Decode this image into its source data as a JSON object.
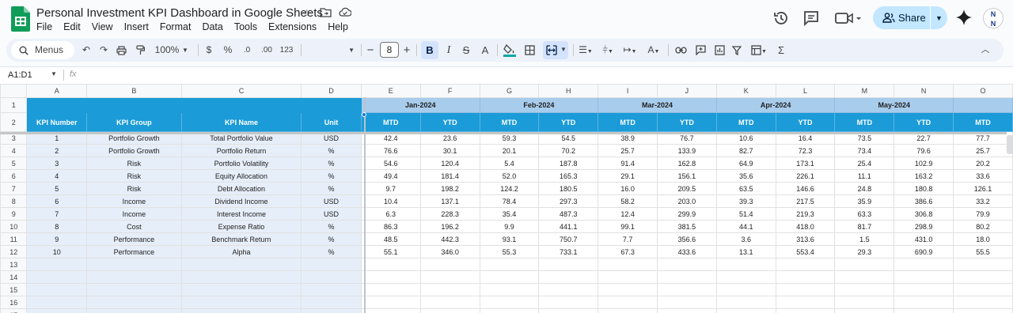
{
  "app": {
    "doc_title": "Personal Investment KPI Dashboard in Google Sheets",
    "share_label": "Share",
    "avatar_initials": "N\nN"
  },
  "menu": [
    "File",
    "Edit",
    "View",
    "Insert",
    "Format",
    "Data",
    "Tools",
    "Extensions",
    "Help"
  ],
  "toolbar": {
    "menus_label": "Menus",
    "zoom": "100%",
    "currency": "$",
    "percent": "%",
    "dec_decrease": ".0",
    "dec_increase": ".00",
    "format_123": "123",
    "font_size": "8",
    "bold": "B",
    "sigma": "Σ"
  },
  "formula_bar": {
    "name_box": "A1:D1",
    "fx": "fx",
    "content": ""
  },
  "columns": [
    "A",
    "B",
    "C",
    "D",
    "E",
    "F",
    "G",
    "H",
    "I",
    "J",
    "K",
    "L",
    "M",
    "N",
    "O"
  ],
  "header_row1": {
    "months": [
      "Jan-2024",
      "Feb-2024",
      "Mar-2024",
      "Apr-2024",
      "May-2024"
    ]
  },
  "header_row2": {
    "kpi_number": "KPI Number",
    "kpi_group": "KPI Group",
    "kpi_name": "KPI Name",
    "unit": "Unit",
    "mtd": "MTD",
    "ytd": "YTD"
  },
  "rows": [
    {
      "n": "1",
      "group": "Portfolio Growth",
      "name": "Total Portfolio Value",
      "unit": "USD",
      "vals": [
        "42.4",
        "23.6",
        "59.3",
        "54.5",
        "38.9",
        "76.7",
        "10.6",
        "16.4",
        "73.5",
        "22.7",
        "77.7"
      ]
    },
    {
      "n": "2",
      "group": "Portfolio Growth",
      "name": "Portfolio Return",
      "unit": "%",
      "vals": [
        "76.6",
        "30.1",
        "20.1",
        "70.2",
        "25.7",
        "133.9",
        "82.7",
        "72.3",
        "73.4",
        "79.6",
        "25.7"
      ]
    },
    {
      "n": "3",
      "group": "Risk",
      "name": "Portfolio Volatility",
      "unit": "%",
      "vals": [
        "54.6",
        "120.4",
        "5.4",
        "187.8",
        "91.4",
        "162.8",
        "64.9",
        "173.1",
        "25.4",
        "102.9",
        "20.2"
      ]
    },
    {
      "n": "4",
      "group": "Risk",
      "name": "Equity Allocation",
      "unit": "%",
      "vals": [
        "49.4",
        "181.4",
        "52.0",
        "165.3",
        "29.1",
        "156.1",
        "35.6",
        "226.1",
        "11.1",
        "163.2",
        "33.6"
      ]
    },
    {
      "n": "5",
      "group": "Risk",
      "name": "Debt Allocation",
      "unit": "%",
      "vals": [
        "9.7",
        "198.2",
        "124.2",
        "180.5",
        "16.0",
        "209.5",
        "63.5",
        "146.6",
        "24.8",
        "180.8",
        "126.1"
      ]
    },
    {
      "n": "6",
      "group": "Income",
      "name": "Dividend Income",
      "unit": "USD",
      "vals": [
        "10.4",
        "137.1",
        "78.4",
        "297.3",
        "58.2",
        "203.0",
        "39.3",
        "217.5",
        "35.9",
        "386.6",
        "33.2"
      ]
    },
    {
      "n": "7",
      "group": "Income",
      "name": "Interest Income",
      "unit": "USD",
      "vals": [
        "6.3",
        "228.3",
        "35.4",
        "487.3",
        "12.4",
        "299.9",
        "51.4",
        "219.3",
        "63.3",
        "306.8",
        "79.9"
      ]
    },
    {
      "n": "8",
      "group": "Cost",
      "name": "Expense Ratio",
      "unit": "%",
      "vals": [
        "86.3",
        "196.2",
        "9.9",
        "441.1",
        "99.1",
        "381.5",
        "44.1",
        "418.0",
        "81.7",
        "298.9",
        "80.2"
      ]
    },
    {
      "n": "9",
      "group": "Performance",
      "name": "Benchmark Return",
      "unit": "%",
      "vals": [
        "48.5",
        "442.3",
        "93.1",
        "750.7",
        "7.7",
        "356.6",
        "3.6",
        "313.6",
        "1.5",
        "431.0",
        "18.0"
      ]
    },
    {
      "n": "10",
      "group": "Performance",
      "name": "Alpha",
      "unit": "%",
      "vals": [
        "55.1",
        "346.0",
        "55.3",
        "733.1",
        "67.3",
        "433.6",
        "13.1",
        "553.4",
        "29.3",
        "690.9",
        "55.5"
      ]
    }
  ],
  "empty_row_numbers": [
    "13",
    "14",
    "15",
    "16",
    "17"
  ],
  "colors": {
    "header_blue": "#1b9bd7",
    "month_blue": "#a8ccec",
    "label_fill": "#e6eef9",
    "share_bg": "#c2e7ff",
    "sheets_green": "#0f9d58"
  }
}
